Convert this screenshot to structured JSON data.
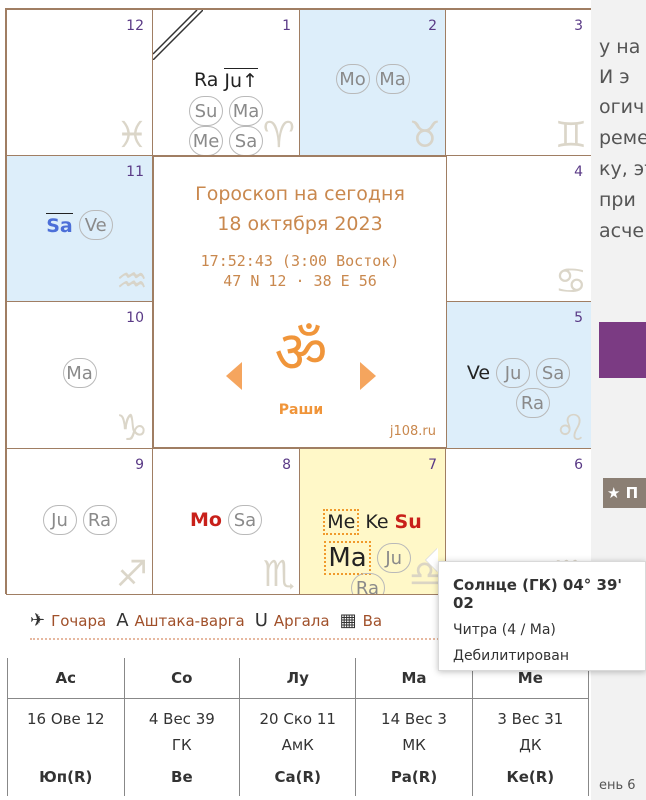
{
  "center": {
    "title_line1": "Гороскоп на сегодня",
    "title_line2": "18 октября 2023",
    "time": "17:52:43 (3:00 Восток)",
    "coords": "47 N 12 · 38 E 56",
    "om_symbol": "ॐ",
    "rashi_label": "Раши",
    "site": "j108.ru"
  },
  "houses": {
    "h1": {
      "num": "1",
      "sign_glyph": "♈",
      "row1": [
        "Ra",
        "Ju↑"
      ],
      "row2": [
        "Su",
        "Ma"
      ],
      "row3": [
        "Me",
        "Sa"
      ]
    },
    "h2": {
      "num": "2",
      "sign_glyph": "♉",
      "row1": [
        "Mo",
        "Ma"
      ]
    },
    "h3": {
      "num": "3",
      "sign_glyph": "♊"
    },
    "h4": {
      "num": "4",
      "sign_glyph": "♋"
    },
    "h5": {
      "num": "5",
      "sign_glyph": "♌",
      "row1": [
        "Ve",
        "Ju",
        "Sa"
      ],
      "row2": [
        "Ra"
      ]
    },
    "h6": {
      "num": "6",
      "sign_glyph": "♍"
    },
    "h7": {
      "num": "7",
      "sign_glyph": "♎",
      "row1": [
        "Me",
        "Ke",
        "Su"
      ],
      "row2": [
        "Ma",
        "Ju"
      ],
      "row3": [
        "Ra"
      ]
    },
    "h8": {
      "num": "8",
      "sign_glyph": "♏",
      "row1": [
        "Mo",
        "Sa"
      ]
    },
    "h9": {
      "num": "9",
      "sign_glyph": "♐",
      "row1": [
        "Ju",
        "Ra"
      ]
    },
    "h10": {
      "num": "10",
      "sign_glyph": "♑",
      "row1": [
        "Ma"
      ]
    },
    "h11": {
      "num": "11",
      "sign_glyph": "♒",
      "row1": [
        "Sa",
        "Ve"
      ]
    },
    "h12": {
      "num": "12",
      "sign_glyph": "♓"
    }
  },
  "tooltip": {
    "title": "Солнце (ГК) 04° 39' 02",
    "nakshatra": "Читра (4 / Ма)",
    "status": "Дебилитирован"
  },
  "tabs": [
    {
      "label": "Гочара",
      "icon": "airplane-icon"
    },
    {
      "label": "Аштака-варга",
      "icon": "letter-a-icon"
    },
    {
      "label": "Аргала",
      "icon": "magnet-icon"
    },
    {
      "label": "Ва",
      "icon": "grid-icon"
    }
  ],
  "table": {
    "headers": [
      "Ас",
      "Со",
      "Лу",
      "Ма",
      "Ме"
    ],
    "values": [
      "16 Ове 12",
      "4 Вес 39",
      "20 Ско 11",
      "14 Вес 3",
      "3 Вес 31"
    ],
    "karakas": [
      "",
      "ГК",
      "АмК",
      "МК",
      "ДК"
    ],
    "headers2": [
      "Юп(R)",
      "Ве",
      "Са(R)",
      "Ра(R)",
      "Ке(R)"
    ]
  },
  "right_panel": {
    "lines": [
      "у на",
      "И э",
      "огич",
      "реме",
      "ку, эт",
      "при",
      "асче"
    ],
    "bar_label": "★ П",
    "bottom_text": "ень 6"
  },
  "colors": {
    "border": "#a07e63",
    "blue_cell": "#ddeefa",
    "yellow_cell": "#fff8c8",
    "orange": "#f0953a",
    "red_planet": "#c8201a",
    "blue_planet": "#4c6fd8"
  }
}
